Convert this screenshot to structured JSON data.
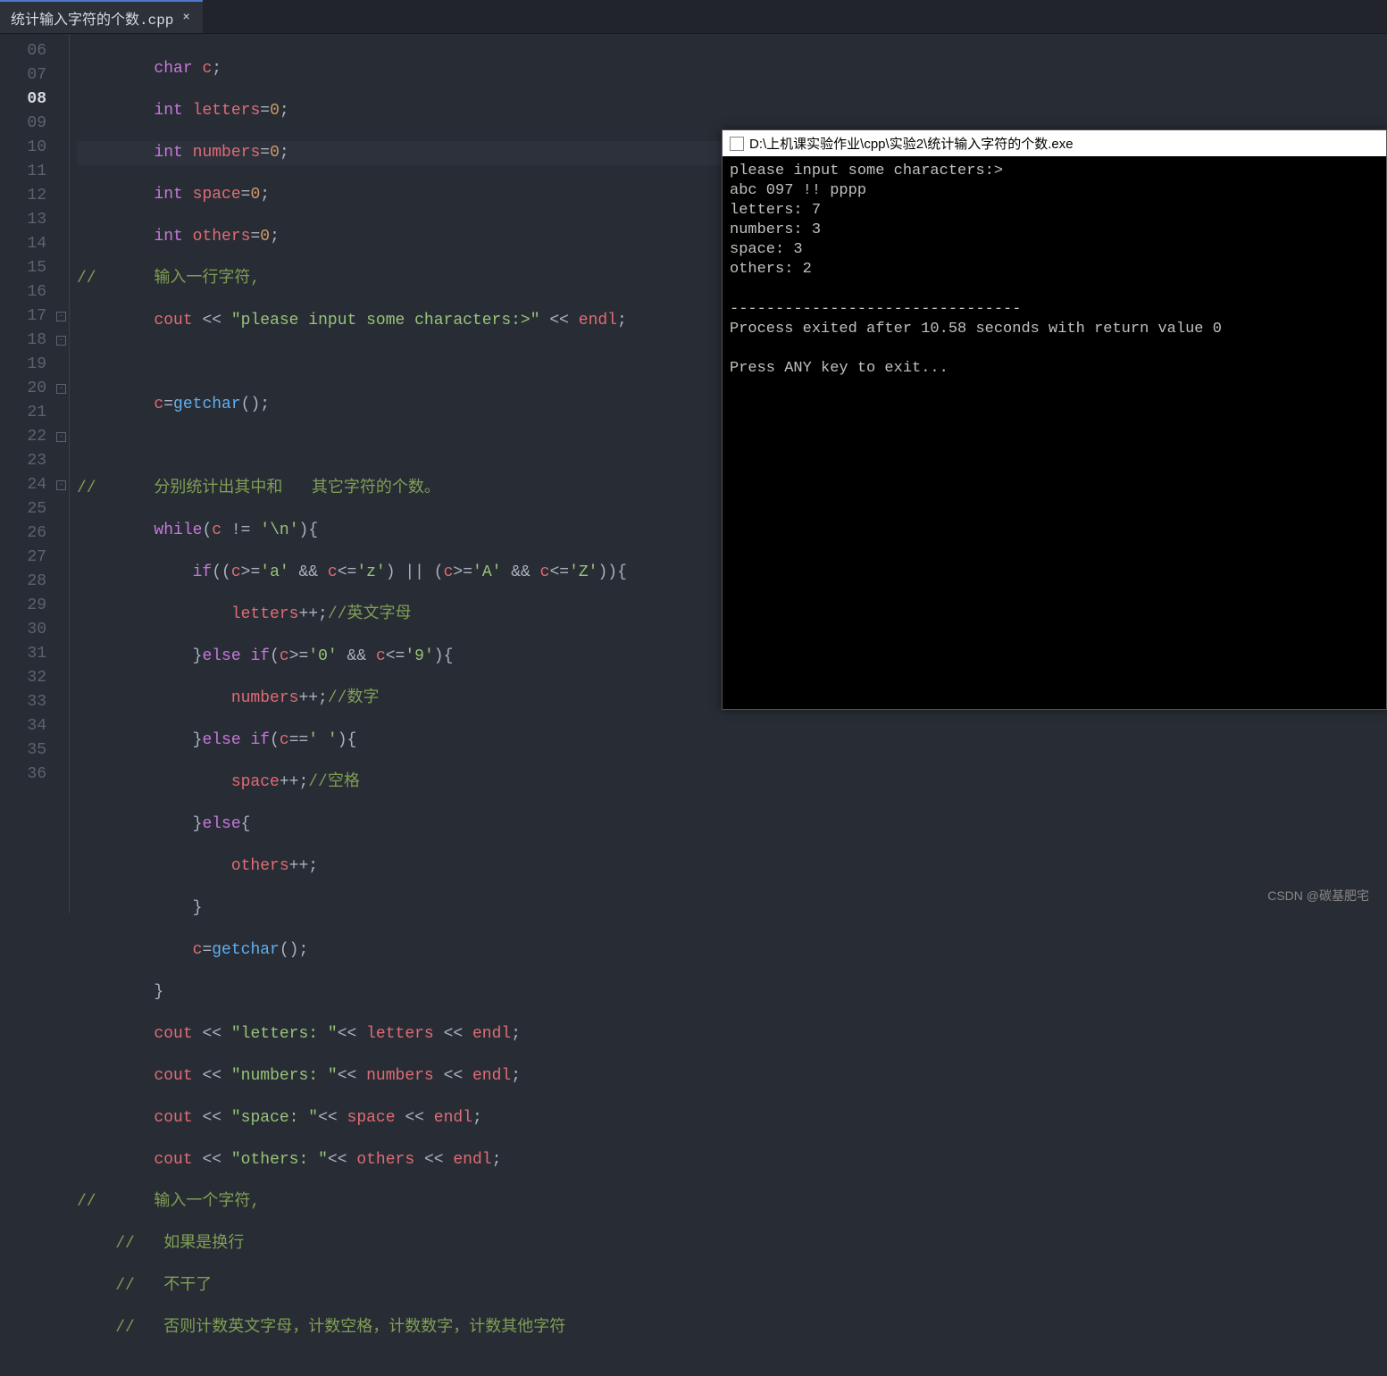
{
  "tab": {
    "filename": "统计输入字符的个数.cpp",
    "close": "×"
  },
  "lineNumbers": [
    "06",
    "07",
    "08",
    "09",
    "10",
    "11",
    "12",
    "13",
    "14",
    "15",
    "16",
    "17",
    "18",
    "19",
    "20",
    "21",
    "22",
    "23",
    "24",
    "25",
    "26",
    "27",
    "28",
    "29",
    "30",
    "31",
    "32",
    "33",
    "34",
    "35",
    "36"
  ],
  "activeLine": "08",
  "code": {
    "l06": {
      "indent": "        ",
      "t1": "char",
      "sp": " ",
      "t2": "c",
      "t3": ";"
    },
    "l07": {
      "indent": "        ",
      "t1": "int",
      "sp": " ",
      "t2": "letters",
      "t3": "=",
      "t4": "0",
      "t5": ";"
    },
    "l08": {
      "indent": "        ",
      "t1": "int",
      "sp": " ",
      "t2": "numbers",
      "t3": "=",
      "t4": "0",
      "t5": ";"
    },
    "l09": {
      "indent": "        ",
      "t1": "int",
      "sp": " ",
      "t2": "space",
      "t3": "=",
      "t4": "0",
      "t5": ";"
    },
    "l10": {
      "indent": "        ",
      "t1": "int",
      "sp": " ",
      "t2": "others",
      "t3": "=",
      "t4": "0",
      "t5": ";"
    },
    "l11": {
      "t1": "//",
      "sp": "      ",
      "t2": "输入一行字符,"
    },
    "l12": {
      "indent": "        ",
      "t1": "cout",
      "sp": " ",
      "t2": "<<",
      "sp2": " ",
      "t3": "\"please input some characters:>\"",
      "sp3": " ",
      "t4": "<<",
      "sp4": " ",
      "t5": "endl",
      "t6": ";"
    },
    "l13": {
      "indent": ""
    },
    "l14": {
      "indent": "        ",
      "t1": "c",
      "t2": "=",
      "t3": "getchar",
      "t4": "();"
    },
    "l15": {
      "indent": ""
    },
    "l16": {
      "t1": "//",
      "sp": "      ",
      "t2": "分别统计出其中和",
      "sp2": "   ",
      "t3": "其它字符的个数。"
    },
    "l17": {
      "indent": "        ",
      "t1": "while",
      "t2": "(",
      "t3": "c",
      "sp": " ",
      "t4": "!=",
      "sp2": " ",
      "t5": "'\\n'",
      "t6": "){"
    },
    "l18": {
      "indent": "            ",
      "t1": "if",
      "t2": "((",
      "t3": "c",
      "t4": ">=",
      "t5": "'a'",
      "sp": " ",
      "t6": "&&",
      "sp2": " ",
      "t7": "c",
      "t8": "<=",
      "t9": "'z'",
      "t10": ")",
      "sp3": " ",
      "t11": "||",
      "sp4": " ",
      "t12": "(",
      "t13": "c",
      "t14": ">=",
      "t15": "'A'",
      "sp5": " ",
      "t16": "&&",
      "sp6": " ",
      "t17": "c",
      "t18": "<=",
      "t19": "'Z'",
      "t20": ")){"
    },
    "l19": {
      "indent": "                ",
      "t1": "letters",
      "t2": "++;",
      "t3": "//英文字母"
    },
    "l20": {
      "indent": "            ",
      "t1": "}",
      "t2": "else if",
      "t3": "(",
      "t4": "c",
      "t5": ">=",
      "t6": "'0'",
      "sp": " ",
      "t7": "&&",
      "sp2": " ",
      "t8": "c",
      "t9": "<=",
      "t10": "'9'",
      "t11": "){"
    },
    "l21": {
      "indent": "                ",
      "t1": "numbers",
      "t2": "++;",
      "t3": "//数字"
    },
    "l22": {
      "indent": "            ",
      "t1": "}",
      "t2": "else if",
      "t3": "(",
      "t4": "c",
      "t5": "==",
      "t6": "' '",
      "t7": "){"
    },
    "l23": {
      "indent": "                ",
      "t1": "space",
      "t2": "++;",
      "t3": "//空格"
    },
    "l24": {
      "indent": "            ",
      "t1": "}",
      "t2": "else",
      "t3": "{"
    },
    "l25": {
      "indent": "                ",
      "t1": "others",
      "t2": "++;"
    },
    "l26": {
      "indent": "            ",
      "t1": "}"
    },
    "l27": {
      "indent": "            ",
      "t1": "c",
      "t2": "=",
      "t3": "getchar",
      "t4": "();"
    },
    "l28": {
      "indent": "        ",
      "t1": "}"
    },
    "l29": {
      "indent": "        ",
      "t1": "cout",
      "sp": " ",
      "t2": "<<",
      "sp2": " ",
      "t3": "\"letters: \"",
      "t4": "<<",
      "sp3": " ",
      "t5": "letters",
      "sp4": " ",
      "t6": "<<",
      "sp5": " ",
      "t7": "endl",
      "t8": ";"
    },
    "l30": {
      "indent": "        ",
      "t1": "cout",
      "sp": " ",
      "t2": "<<",
      "sp2": " ",
      "t3": "\"numbers: \"",
      "t4": "<<",
      "sp3": " ",
      "t5": "numbers",
      "sp4": " ",
      "t6": "<<",
      "sp5": " ",
      "t7": "endl",
      "t8": ";"
    },
    "l31": {
      "indent": "        ",
      "t1": "cout",
      "sp": " ",
      "t2": "<<",
      "sp2": " ",
      "t3": "\"space: \"",
      "t4": "<<",
      "sp3": " ",
      "t5": "space",
      "sp4": " ",
      "t6": "<<",
      "sp5": " ",
      "t7": "endl",
      "t8": ";"
    },
    "l32": {
      "indent": "        ",
      "t1": "cout",
      "sp": " ",
      "t2": "<<",
      "sp2": " ",
      "t3": "\"others: \"",
      "t4": "<<",
      "sp3": " ",
      "t5": "others",
      "sp4": " ",
      "t6": "<<",
      "sp5": " ",
      "t7": "endl",
      "t8": ";"
    },
    "l33": {
      "t1": "//",
      "sp": "      ",
      "t2": "输入一个字符,"
    },
    "l34": {
      "indent": "    ",
      "t1": "//",
      "sp": "   ",
      "t2": "如果是换行"
    },
    "l35": {
      "indent": "    ",
      "t1": "//",
      "sp": "   ",
      "t2": "不干了"
    },
    "l36": {
      "indent": "    ",
      "t1": "//",
      "sp": "   ",
      "t2": "否则计数英文字母，计数空格，计数数字，计数其他字符"
    }
  },
  "foldMarkers": {
    "17": "-",
    "18": "-",
    "20": "-",
    "22": "-",
    "24": "-"
  },
  "console": {
    "title": "D:\\上机课实验作业\\cpp\\实验2\\统计输入字符的个数.exe",
    "l1": "please input some characters:>",
    "l2": "abc 097 !! pppp",
    "l3": "letters: 7",
    "l4": "numbers: 3",
    "l5": "space: 3",
    "l6": "others: 2",
    "l7": "",
    "l8": "--------------------------------",
    "l9": "Process exited after 10.58 seconds with return value 0",
    "l10": "",
    "l11": "Press ANY key to exit..."
  },
  "watermark": "CSDN @碳基肥宅"
}
